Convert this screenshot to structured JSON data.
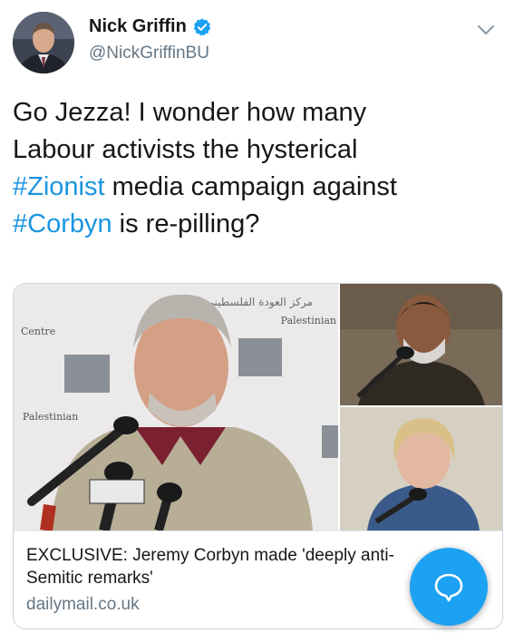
{
  "author": {
    "display_name": "Nick Griffin",
    "handle": "@NickGriffinBU",
    "verified_icon": "verified-badge-icon"
  },
  "tweet": {
    "line1": "Go Jezza! I wonder how many",
    "line2": "Labour activists the hysterical",
    "line3_hashtag": "#Zionist",
    "line3_rest": " media campaign against",
    "line4_hashtag": "#Corbyn",
    "line4_rest": " is re-pilling?"
  },
  "card": {
    "title_line1": "EXCLUSIVE: Jeremy Corbyn made 'deeply anti-",
    "title_line2": "Semitic remarks'",
    "domain": "dailymail.co.uk",
    "backdrop_text_en": "Palestinian",
    "backdrop_text_centre": "Centre",
    "backdrop_text_ar": "مركز العودة الفلسطيني"
  },
  "colors": {
    "accent": "#1da1f2",
    "hashtag": "#1b95e0",
    "text": "#14171a",
    "secondary": "#657786"
  },
  "icons": {
    "menu": "chevron-down-icon",
    "compose": "reply-bubble-icon"
  }
}
